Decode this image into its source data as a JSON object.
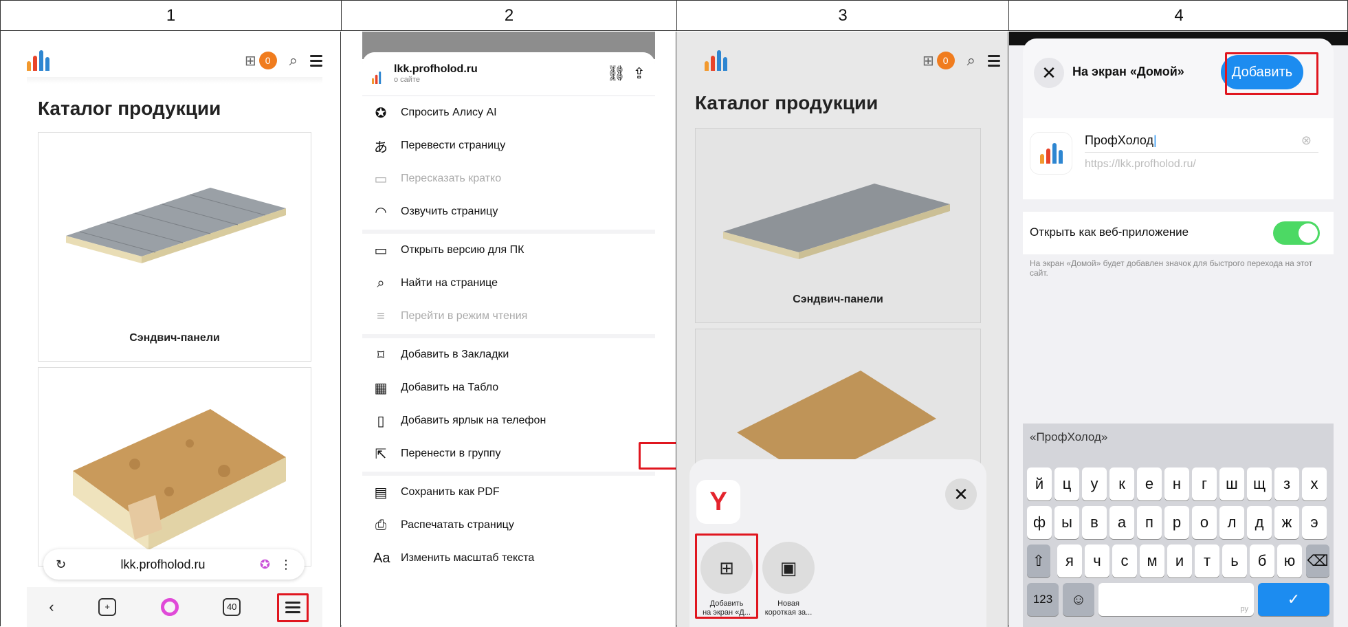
{
  "headers": [
    "1",
    "2",
    "3",
    "4"
  ],
  "site": {
    "catalog_title": "Каталог продукции",
    "cart_count": "0",
    "product_1": "Сэндвич-панели",
    "url": "lkk.profholod.ru",
    "tabs_count": "40"
  },
  "menu": {
    "host": "lkk.profholod.ru",
    "about": "о сайте",
    "items_a": [
      {
        "label": "Спросить Алису AI",
        "icon": "alice-ai-icon",
        "dim": false
      },
      {
        "label": "Перевести страницу",
        "icon": "translate-icon",
        "dim": false
      },
      {
        "label": "Пересказать кратко",
        "icon": "summary-icon",
        "dim": true
      },
      {
        "label": "Озвучить страницу",
        "icon": "headphones-icon",
        "dim": false
      }
    ],
    "items_b": [
      {
        "label": "Открыть версию для ПК",
        "icon": "monitor-icon",
        "dim": false
      },
      {
        "label": "Найти на странице",
        "icon": "search-icon",
        "dim": false
      },
      {
        "label": "Перейти в режим чтения",
        "icon": "reader-icon",
        "dim": true
      }
    ],
    "items_c": [
      {
        "label": "Добавить в Закладки",
        "icon": "bookmark-icon",
        "dim": false
      },
      {
        "label": "Добавить на Табло",
        "icon": "tablo-icon",
        "dim": false
      },
      {
        "label": "Добавить ярлык на телефон",
        "icon": "phone-shortcut-icon",
        "dim": false
      },
      {
        "label": "Перенести в группу",
        "icon": "move-group-icon",
        "dim": false
      }
    ],
    "items_d": [
      {
        "label": "Сохранить как PDF",
        "icon": "pdf-icon",
        "dim": false
      },
      {
        "label": "Распечатать страницу",
        "icon": "print-icon",
        "dim": false
      },
      {
        "label": "Изменить масштаб текста",
        "icon": "text-size-icon",
        "dim": false
      }
    ]
  },
  "share": {
    "action_add_line1": "Добавить",
    "action_add_line2": "на экран «Д...",
    "action_new_line1": "Новая",
    "action_new_line2": "короткая за..."
  },
  "home": {
    "title": "На экран «Домой»",
    "add_label": "Добавить",
    "name_value": "ПрофХолод",
    "url_placeholder": "https://lkk.profholod.ru/",
    "webapp_label": "Открыть как веб-приложение",
    "hint": "На экран «Домой» будет добавлен значок для быстрого перехода на этот сайт.",
    "suggestion": "«ПрофХолод»",
    "row1": [
      "й",
      "ц",
      "у",
      "к",
      "е",
      "н",
      "г",
      "ш",
      "щ",
      "з",
      "х"
    ],
    "row2": [
      "ф",
      "ы",
      "в",
      "а",
      "п",
      "р",
      "о",
      "л",
      "д",
      "ж",
      "э"
    ],
    "row3": [
      "я",
      "ч",
      "с",
      "м",
      "и",
      "т",
      "ь",
      "б",
      "ю"
    ],
    "num_key": "123",
    "lang": "ру"
  },
  "colors": {
    "accent_red": "#e0161f",
    "ios_blue": "#1c8cf0",
    "toggle_green": "#4cd964",
    "badge_orange": "#f07c1e"
  }
}
